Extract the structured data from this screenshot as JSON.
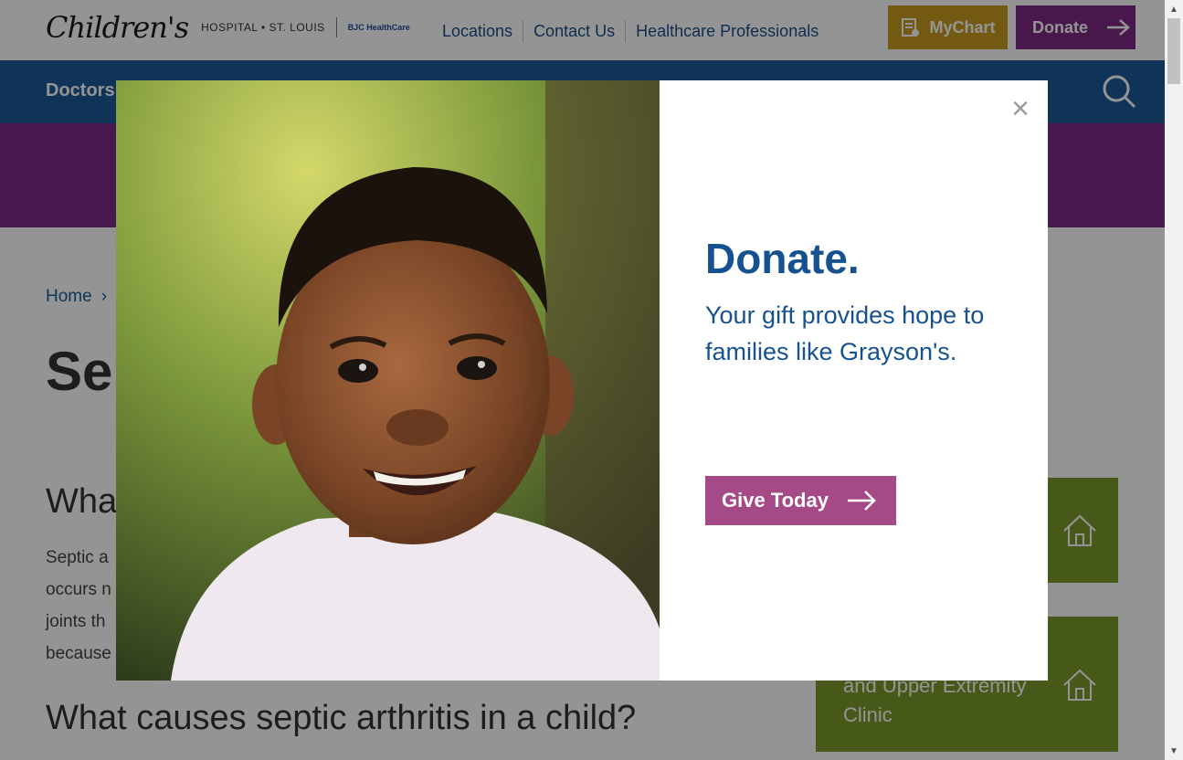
{
  "header": {
    "logo": {
      "script": "Children's",
      "subtitle": "HOSPITAL • ST. LOUIS",
      "partner": "BJC HealthCare"
    },
    "top_links": [
      "Locations",
      "Contact Us",
      "Healthcare Professionals"
    ],
    "mychart_label": "MyChart",
    "donate_label": "Donate"
  },
  "nav": {
    "visible_item": "Doctors"
  },
  "breadcrumb": {
    "home": "Home"
  },
  "page": {
    "title_visible": "Sep",
    "section_heading_visible": "Wha",
    "body_lines_visible": [
      "Septic a",
      "occurs n",
      "joints th",
      "because"
    ],
    "section_heading_2": "What causes septic arthritis in a child?"
  },
  "sidebar_cards": [
    {
      "label": ""
    },
    {
      "label": "and Upper Extremity Clinic"
    }
  ],
  "modal": {
    "title": "Donate.",
    "text": "Your gift provides hope to families like Grayson's.",
    "button_label": "Give Today",
    "close_symbol": "×",
    "photo_alt": "Smiling child"
  },
  "colors": {
    "nav_blue": "#1a5a96",
    "purple": "#7b2c87",
    "modal_blue": "#15528f",
    "give_button": "#a64a87",
    "mychart_gold": "#c99a22",
    "card_green": "#7a9a2a"
  }
}
